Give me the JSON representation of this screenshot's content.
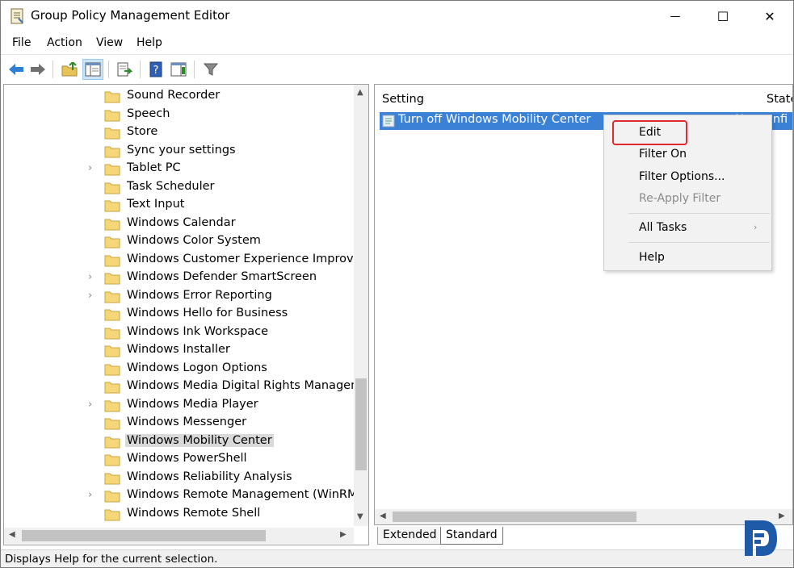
{
  "window": {
    "title": "Group Policy Management Editor",
    "minimize_symbol": "—",
    "maximize_symbol": "☐",
    "close_symbol": "✕"
  },
  "menubar": {
    "items": [
      "File",
      "Action",
      "View",
      "Help"
    ]
  },
  "toolbar": {
    "icons": [
      "back-arrow-icon",
      "forward-arrow-icon",
      "up-folder-icon",
      "show-hide-console-tree-icon",
      "export-list-icon",
      "help-icon",
      "show-hide-action-pane-icon",
      "filter-icon"
    ]
  },
  "tree": {
    "items": [
      {
        "label": "Sound Recorder",
        "expandable": false
      },
      {
        "label": "Speech",
        "expandable": false
      },
      {
        "label": "Store",
        "expandable": false
      },
      {
        "label": "Sync your settings",
        "expandable": false
      },
      {
        "label": "Tablet PC",
        "expandable": true
      },
      {
        "label": "Task Scheduler",
        "expandable": false
      },
      {
        "label": "Text Input",
        "expandable": false
      },
      {
        "label": "Windows Calendar",
        "expandable": false
      },
      {
        "label": "Windows Color System",
        "expandable": false
      },
      {
        "label": "Windows Customer Experience Improvemer",
        "expandable": false
      },
      {
        "label": "Windows Defender SmartScreen",
        "expandable": true
      },
      {
        "label": "Windows Error Reporting",
        "expandable": true
      },
      {
        "label": "Windows Hello for Business",
        "expandable": false
      },
      {
        "label": "Windows Ink Workspace",
        "expandable": false
      },
      {
        "label": "Windows Installer",
        "expandable": false
      },
      {
        "label": "Windows Logon Options",
        "expandable": false
      },
      {
        "label": "Windows Media Digital Rights Managemen",
        "expandable": false
      },
      {
        "label": "Windows Media Player",
        "expandable": true
      },
      {
        "label": "Windows Messenger",
        "expandable": false
      },
      {
        "label": "Windows Mobility Center",
        "expandable": false,
        "selected": true
      },
      {
        "label": "Windows PowerShell",
        "expandable": false
      },
      {
        "label": "Windows Reliability Analysis",
        "expandable": false
      },
      {
        "label": "Windows Remote Management (WinRM)",
        "expandable": true
      },
      {
        "label": "Windows Remote Shell",
        "expandable": false
      }
    ]
  },
  "details": {
    "columns": [
      "Setting",
      "State"
    ],
    "rows": [
      {
        "setting": "Turn off Windows Mobility Center",
        "state": "Not configured",
        "state_visible": "Not confi"
      }
    ]
  },
  "tabs": [
    "Extended",
    "Standard"
  ],
  "context_menu": {
    "items": [
      {
        "label": "Edit",
        "disabled": false,
        "highlighted": true
      },
      {
        "label": "Filter On",
        "disabled": false
      },
      {
        "label": "Filter Options...",
        "disabled": false
      },
      {
        "label": "Re-Apply Filter",
        "disabled": true
      },
      {
        "label": "All Tasks",
        "disabled": false,
        "submenu": true
      },
      {
        "label": "Help",
        "disabled": false
      }
    ]
  },
  "statusbar": {
    "text": "Displays Help for the current selection."
  },
  "colors": {
    "selection_blue": "#3b82d6",
    "highlight_red": "#e0282d",
    "tree_selected": "#d9d9d9",
    "logo_blue": "#1e5aa8"
  }
}
